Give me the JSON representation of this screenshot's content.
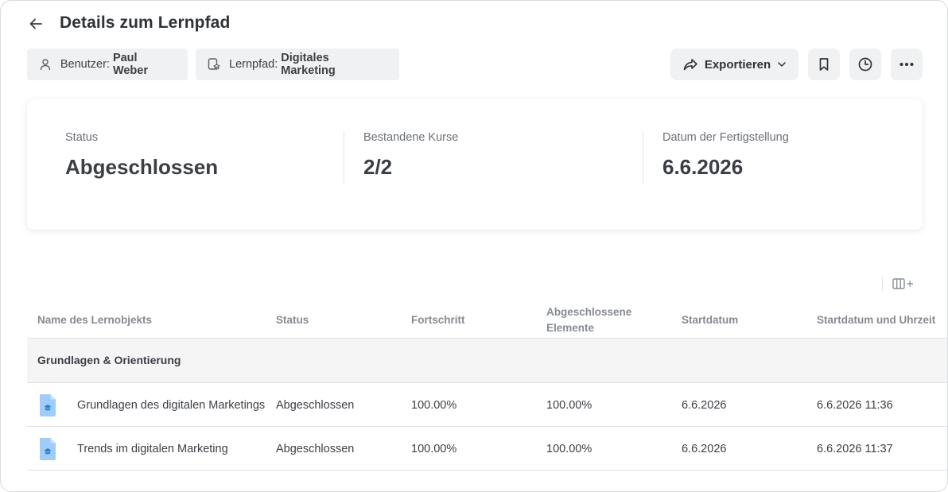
{
  "header": {
    "title": "Details zum Lernpfad",
    "back_icon": "arrow-left-icon"
  },
  "filters": {
    "user": {
      "key": "Benutzer:",
      "value": "Paul Weber",
      "icon": "user-icon"
    },
    "path": {
      "key": "Lernpfad:",
      "value": "Digitales Marketing",
      "icon": "learning-path-icon"
    }
  },
  "toolbar": {
    "export_label": "Exportieren",
    "export_icon": "share-forward-icon",
    "bookmark_icon": "bookmark-icon",
    "history_icon": "clock-icon",
    "more_icon": "more-horizontal-icon"
  },
  "summary": {
    "status_label": "Status",
    "status_value": "Abgeschlossen",
    "courses_label": "Bestandene Kurse",
    "courses_value": "2/2",
    "completion_label": "Datum der Fertigstellung",
    "completion_value": "6.6.2026"
  },
  "table": {
    "columns": [
      "Name des Lernobjekts",
      "Status",
      "Fortschritt",
      "Abgeschlossene Elemente",
      "Startdatum",
      "Startdatum und Uhrzeit"
    ],
    "group_label": "Grundlagen & Orientierung",
    "rows": [
      {
        "name": "Grundlagen des digitalen Marketings",
        "status": "Abgeschlossen",
        "progress": "100.00%",
        "completed": "100.00%",
        "start_date": "6.6.2026",
        "start_datetime": "6.6.2026 11:36"
      },
      {
        "name": "Trends im digitalen Marketing",
        "status": "Abgeschlossen",
        "progress": "100.00%",
        "completed": "100.00%",
        "start_date": "6.6.2026",
        "start_datetime": "6.6.2026 11:37"
      }
    ]
  },
  "colors": {
    "chip_bg": "#f0f1f2",
    "icon_blue": "#9fcdf7",
    "icon_blue_dark": "#2e7fd6"
  }
}
